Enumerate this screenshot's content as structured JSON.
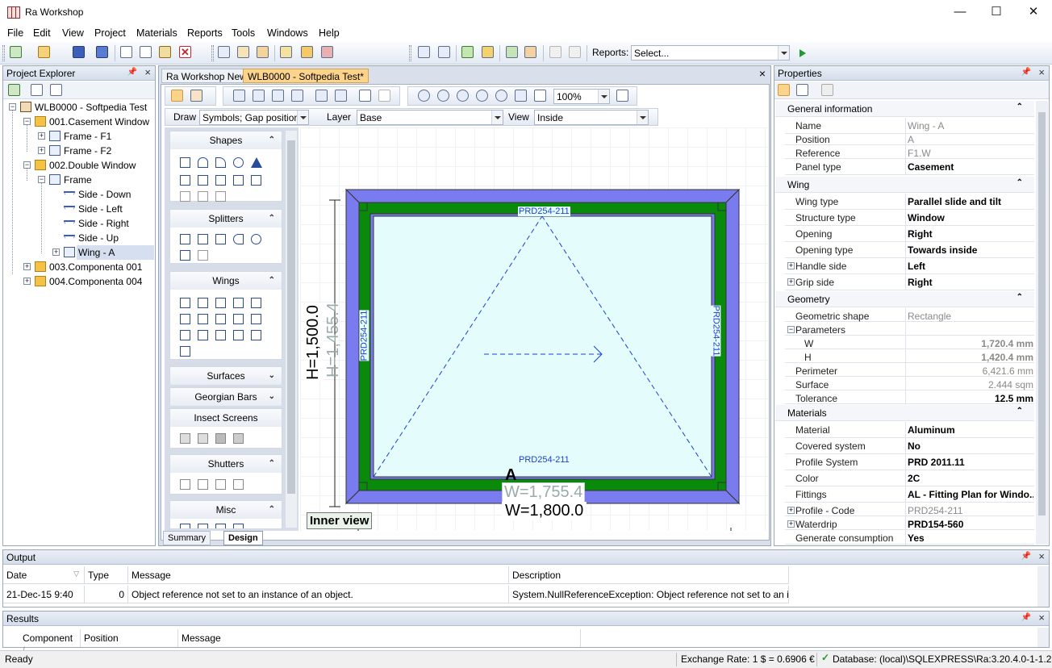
{
  "window": {
    "title": "Ra Workshop",
    "minimize": "—",
    "maximize": "☐",
    "close": "✕"
  },
  "menu": [
    "File",
    "Edit",
    "View",
    "Project",
    "Materials",
    "Reports",
    "Tools",
    "Windows",
    "Help"
  ],
  "toolbar": {
    "reports_label": "Reports:",
    "reports_select": "Select..."
  },
  "project_explorer": {
    "title": "Project Explorer",
    "nodes": [
      {
        "label": "WLB0000 - Softpedia Test",
        "icon": "project-icon"
      },
      {
        "label": "001.Casement Window",
        "icon": "folder-icon"
      },
      {
        "label": "Frame - F1",
        "icon": "frame-icon"
      },
      {
        "label": "Frame - F2",
        "icon": "frame-icon"
      },
      {
        "label": "002.Double Window",
        "icon": "folder-icon"
      },
      {
        "label": "Frame",
        "icon": "frame-icon"
      },
      {
        "label": "Side - Down",
        "icon": "side-icon"
      },
      {
        "label": "Side - Left",
        "icon": "side-icon"
      },
      {
        "label": "Side - Right",
        "icon": "side-icon"
      },
      {
        "label": "Side - Up",
        "icon": "side-icon"
      },
      {
        "label": "Wing - A",
        "icon": "wing-icon"
      },
      {
        "label": "003.Componenta 001",
        "icon": "folder-icon"
      },
      {
        "label": "004.Componenta 004",
        "icon": "folder-icon"
      }
    ]
  },
  "doc_tabs": [
    "Ra Workshop News",
    "WLB0000 - Softpedia Test*"
  ],
  "design_toolbar": {
    "zoom": "100%",
    "draw_label": "Draw",
    "draw_select": "Symbols; Gap positions; ...",
    "layer_label": "Layer",
    "layer_select": "Base",
    "view_label": "View",
    "view_select": "Inside"
  },
  "shape_panels": [
    {
      "title": "Shapes",
      "chevron": "⌃"
    },
    {
      "title": "Splitters",
      "chevron": "⌃"
    },
    {
      "title": "Wings",
      "chevron": "⌃"
    },
    {
      "title": "Surfaces",
      "chevron": "⌄"
    },
    {
      "title": "Georgian Bars",
      "chevron": "⌄"
    },
    {
      "title": "Insect Screens",
      "chevron": "⌃"
    },
    {
      "title": "Shutters",
      "chevron": "⌃"
    },
    {
      "title": "Misc",
      "chevron": "⌃"
    }
  ],
  "drawing": {
    "profile_top": "PRD254-211",
    "profile_bottom": "PRD254-211",
    "profile_left": "PRD254-211",
    "profile_right": "PRD254-211",
    "height_outer": "H=1,500.0",
    "height_inner": "H=1,455.4",
    "width_outer": "W=1,800.0",
    "width_inner": "W=1,755.4",
    "wing_label": "A",
    "view_badge": "Inner view",
    "colors": {
      "frame": "#7b7bf0",
      "sash": "#0a8a0a",
      "glass": "#e4fcfc"
    }
  },
  "bottom_tabs": [
    "Summary",
    "Design"
  ],
  "properties": {
    "title": "Properties",
    "sections": [
      {
        "title": "General information",
        "rows": [
          {
            "k": "Name",
            "v": "Wing - A",
            "style": "gray"
          },
          {
            "k": "Position",
            "v": "A",
            "style": "gray"
          },
          {
            "k": "Reference",
            "v": "F1.W",
            "style": "gray"
          },
          {
            "k": "Panel type",
            "v": "Casement",
            "style": "bold"
          }
        ]
      },
      {
        "title": "Wing",
        "rows": [
          {
            "k": "Wing type",
            "v": "Parallel slide and tilt",
            "style": "bold"
          },
          {
            "k": "Structure type",
            "v": "Window",
            "style": "bold"
          },
          {
            "k": "Opening",
            "v": "Right",
            "style": "bold"
          },
          {
            "k": "Opening type",
            "v": "Towards inside",
            "style": "bold"
          },
          {
            "k": "Handle side",
            "v": "Left",
            "style": "bold",
            "expand": "+"
          },
          {
            "k": "Grip side",
            "v": "Right",
            "style": "bold",
            "expand": "+"
          }
        ]
      },
      {
        "title": "Geometry",
        "rows": [
          {
            "k": "Geometric shape",
            "v": "Rectangle",
            "style": "gray"
          },
          {
            "k": "Parameters",
            "v": "",
            "style": "gray",
            "expand": "−"
          },
          {
            "k": "W",
            "v": "1,720.4 mm",
            "style": "gray right"
          },
          {
            "k": "H",
            "v": "1,420.4 mm",
            "style": "gray right"
          },
          {
            "k": "Perimeter",
            "v": "6,421.6 mm",
            "style": "gray right"
          },
          {
            "k": "Surface",
            "v": "2.444 sqm",
            "style": "gray right"
          },
          {
            "k": "Tolerance",
            "v": "12.5 mm",
            "style": "bold right"
          }
        ]
      },
      {
        "title": "Materials",
        "rows": [
          {
            "k": "Material",
            "v": "Aluminum",
            "style": "bold"
          },
          {
            "k": "Covered system",
            "v": "No",
            "style": "bold"
          },
          {
            "k": "Profile System",
            "v": "PRD 2011.11",
            "style": "bold"
          },
          {
            "k": "Color",
            "v": "2C",
            "style": "bold"
          },
          {
            "k": "Fittings",
            "v": "AL - Fitting Plan for Windo...",
            "style": "bold"
          },
          {
            "k": "Profile - Code",
            "v": "PRD254-211",
            "style": "gray",
            "expand": "+"
          },
          {
            "k": "Waterdrip",
            "v": "PRD154-560",
            "style": "bold",
            "expand": "+"
          },
          {
            "k": "Generate consumption",
            "v": "Yes",
            "style": "bold"
          }
        ]
      }
    ]
  },
  "output": {
    "title": "Output",
    "columns": [
      "Date",
      "Type",
      "Message",
      "Description"
    ],
    "rows": [
      {
        "date": "21-Dec-15 9:40",
        "type": "0",
        "message": "Object reference not set to an instance of an object.",
        "description": "System.NullReferenceException: Object reference not set to an inst..."
      }
    ]
  },
  "results": {
    "title": "Results",
    "columns": [
      "Component",
      "Position",
      "Message"
    ]
  },
  "status": {
    "left": "Ready",
    "rate": "Exchange Rate: 1 $ = 0.6906 €",
    "db": "Database: (local)\\SQLEXPRESS\\Ra:3.20.4.0-1-1.2"
  }
}
